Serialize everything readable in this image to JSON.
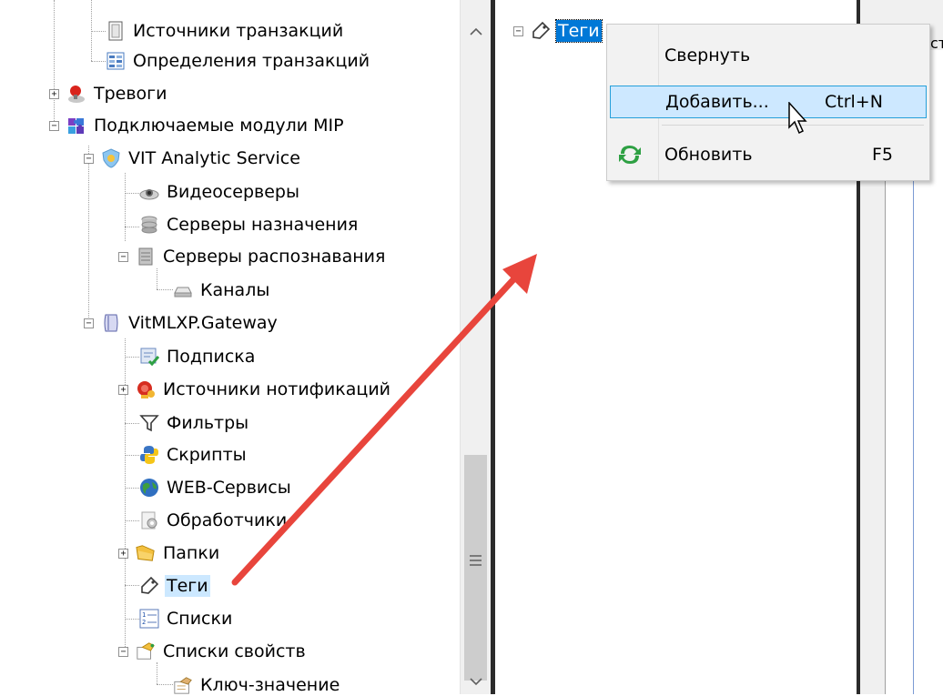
{
  "left_tree": {
    "items": [
      {
        "label": "Источники транзакций",
        "icon": "document-icon"
      },
      {
        "label": "Определения транзакций",
        "icon": "table-icon"
      },
      {
        "label": "Тревоги",
        "icon": "alarm-icon"
      },
      {
        "label": "Подключаемые модули MIP",
        "icon": "puzzle-icon"
      },
      {
        "label": "VIT Analytic Service",
        "icon": "shield-icon"
      },
      {
        "label": "Видеосерверы",
        "icon": "camera-icon"
      },
      {
        "label": "Серверы назначения",
        "icon": "database-icon"
      },
      {
        "label": "Серверы распознавания",
        "icon": "server-icon"
      },
      {
        "label": "Каналы",
        "icon": "channel-icon"
      },
      {
        "label": "VitMLXP.Gateway",
        "icon": "gateway-icon"
      },
      {
        "label": "Подписка",
        "icon": "subscription-icon"
      },
      {
        "label": "Источники нотификаций",
        "icon": "notification-icon"
      },
      {
        "label": "Фильтры",
        "icon": "filter-icon"
      },
      {
        "label": "Скрипты",
        "icon": "python-icon"
      },
      {
        "label": "WEB-Сервисы",
        "icon": "globe-icon"
      },
      {
        "label": "Обработчики",
        "icon": "handler-icon"
      },
      {
        "label": "Папки",
        "icon": "folder-icon"
      },
      {
        "label": "Теги",
        "icon": "tag-icon"
      },
      {
        "label": "Списки",
        "icon": "list-icon"
      },
      {
        "label": "Списки свойств",
        "icon": "property-list-icon"
      },
      {
        "label": "Ключ-значение",
        "icon": "key-value-icon"
      }
    ]
  },
  "middle_tree": {
    "root_label": "Теги",
    "right_fragment": "ст"
  },
  "context_menu": {
    "items": [
      {
        "label": "Свернуть",
        "shortcut": ""
      },
      {
        "label": "Добавить...",
        "shortcut": "Ctrl+N"
      },
      {
        "label": "Обновить",
        "shortcut": "F5"
      }
    ]
  },
  "colors": {
    "accent": "#0078d7",
    "selection": "#cce8ff",
    "menu_highlight": "#cde8ff",
    "arrow": "#e8453c"
  }
}
